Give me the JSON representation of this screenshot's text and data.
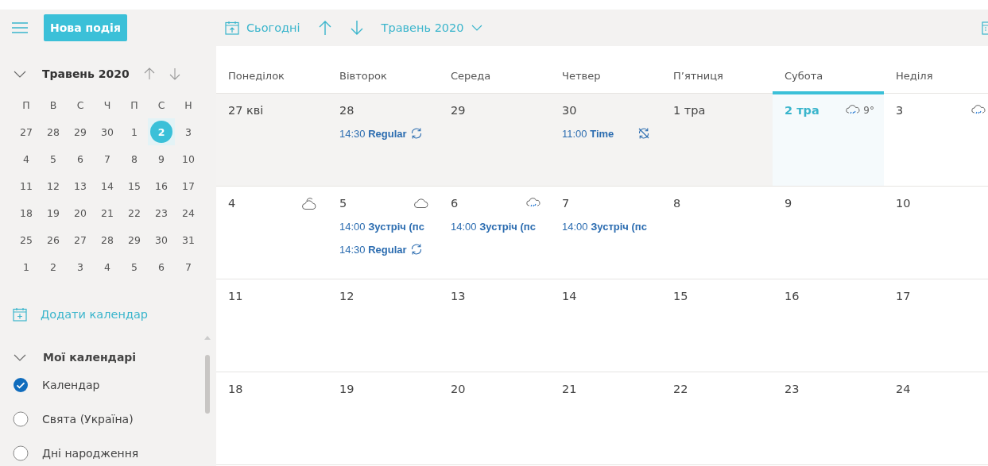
{
  "toolbar": {
    "new_event": "Нова подія",
    "today": "Сьогодні",
    "period": "Травень 2020"
  },
  "mini_calendar": {
    "title": "Травень 2020",
    "weekdays": [
      "П",
      "В",
      "С",
      "Ч",
      "П",
      "С",
      "Н"
    ],
    "weeks": [
      [
        {
          "label": "27",
          "selected": false
        },
        {
          "label": "28",
          "selected": false
        },
        {
          "label": "29",
          "selected": false
        },
        {
          "label": "30",
          "selected": false
        },
        {
          "label": "1",
          "selected": false
        },
        {
          "label": "2",
          "selected": true
        },
        {
          "label": "3",
          "selected": false
        }
      ],
      [
        {
          "label": "4",
          "selected": false
        },
        {
          "label": "5",
          "selected": false
        },
        {
          "label": "6",
          "selected": false
        },
        {
          "label": "7",
          "selected": false
        },
        {
          "label": "8",
          "selected": false
        },
        {
          "label": "9",
          "selected": false
        },
        {
          "label": "10",
          "selected": false
        }
      ],
      [
        {
          "label": "11",
          "selected": false
        },
        {
          "label": "12",
          "selected": false
        },
        {
          "label": "13",
          "selected": false
        },
        {
          "label": "14",
          "selected": false
        },
        {
          "label": "15",
          "selected": false
        },
        {
          "label": "16",
          "selected": false
        },
        {
          "label": "17",
          "selected": false
        }
      ],
      [
        {
          "label": "18",
          "selected": false
        },
        {
          "label": "19",
          "selected": false
        },
        {
          "label": "20",
          "selected": false
        },
        {
          "label": "21",
          "selected": false
        },
        {
          "label": "22",
          "selected": false
        },
        {
          "label": "23",
          "selected": false
        },
        {
          "label": "24",
          "selected": false
        }
      ],
      [
        {
          "label": "25",
          "selected": false
        },
        {
          "label": "26",
          "selected": false
        },
        {
          "label": "27",
          "selected": false
        },
        {
          "label": "28",
          "selected": false
        },
        {
          "label": "29",
          "selected": false
        },
        {
          "label": "30",
          "selected": false
        },
        {
          "label": "31",
          "selected": false
        }
      ],
      [
        {
          "label": "1",
          "selected": false
        },
        {
          "label": "2",
          "selected": false
        },
        {
          "label": "3",
          "selected": false
        },
        {
          "label": "4",
          "selected": false
        },
        {
          "label": "5",
          "selected": false
        },
        {
          "label": "6",
          "selected": false
        },
        {
          "label": "7",
          "selected": false
        }
      ]
    ]
  },
  "add_calendar": "Додати календар",
  "my_calendars": {
    "title": "Мої календарі",
    "expanded": true,
    "items": [
      {
        "label": "Календар",
        "checked": true
      },
      {
        "label": "Свята (Україна)",
        "checked": false
      },
      {
        "label": "Дні народження",
        "checked": false
      }
    ]
  },
  "columns": [
    {
      "label": "Понеділок",
      "selected": false
    },
    {
      "label": "Вівторок",
      "selected": false
    },
    {
      "label": "Середа",
      "selected": false
    },
    {
      "label": "Четвер",
      "selected": false
    },
    {
      "label": "П’ятниця",
      "selected": false
    },
    {
      "label": "Субота",
      "selected": true
    },
    {
      "label": "Неділя",
      "selected": false
    }
  ],
  "weeks": [
    [
      {
        "label": "27 кві",
        "kind": "plain",
        "outside": true,
        "today": false
      },
      {
        "label": "28",
        "kind": "plain",
        "outside": true,
        "today": false,
        "events": [
          {
            "time": "14:30",
            "title": "Regular",
            "kind": "recurring"
          }
        ]
      },
      {
        "label": "29",
        "kind": "plain",
        "outside": true,
        "today": false
      },
      {
        "label": "30",
        "kind": "plain",
        "outside": true,
        "today": false,
        "events": [
          {
            "time": "11:00",
            "title": "Time",
            "kind": "exception"
          }
        ]
      },
      {
        "label": "1 тра",
        "kind": "plain",
        "outside": true,
        "today": false
      },
      {
        "label": "2 тра",
        "kind": "rain",
        "outside": false,
        "today": true,
        "temp": "9°"
      },
      {
        "label": "3",
        "kind": "rain",
        "outside": false,
        "today": false
      }
    ],
    [
      {
        "label": "4",
        "kind": "partly-cloudy",
        "outside": false,
        "today": false
      },
      {
        "label": "5",
        "kind": "cloudy",
        "outside": false,
        "today": false,
        "events": [
          {
            "time": "14:00",
            "title": "Зустріч (пс",
            "kind": "single"
          },
          {
            "time": "14:30",
            "title": "Regular",
            "kind": "recurring"
          }
        ]
      },
      {
        "label": "6",
        "kind": "rain",
        "outside": false,
        "today": false,
        "events": [
          {
            "time": "14:00",
            "title": "Зустріч (пс",
            "kind": "single"
          }
        ]
      },
      {
        "label": "7",
        "kind": "plain",
        "outside": false,
        "today": false,
        "events": [
          {
            "time": "14:00",
            "title": "Зустріч (пс",
            "kind": "single"
          }
        ]
      },
      {
        "label": "8",
        "kind": "plain",
        "outside": false,
        "today": false
      },
      {
        "label": "9",
        "kind": "plain",
        "outside": false,
        "today": false
      },
      {
        "label": "10",
        "kind": "plain",
        "outside": false,
        "today": false
      }
    ],
    [
      {
        "label": "11",
        "kind": "plain",
        "outside": false,
        "today": false
      },
      {
        "label": "12",
        "kind": "plain",
        "outside": false,
        "today": false
      },
      {
        "label": "13",
        "kind": "plain",
        "outside": false,
        "today": false
      },
      {
        "label": "14",
        "kind": "plain",
        "outside": false,
        "today": false
      },
      {
        "label": "15",
        "kind": "plain",
        "outside": false,
        "today": false
      },
      {
        "label": "16",
        "kind": "plain",
        "outside": false,
        "today": false
      },
      {
        "label": "17",
        "kind": "plain",
        "outside": false,
        "today": false
      }
    ],
    [
      {
        "label": "18",
        "kind": "plain",
        "outside": false,
        "today": false
      },
      {
        "label": "19",
        "kind": "plain",
        "outside": false,
        "today": false
      },
      {
        "label": "20",
        "kind": "plain",
        "outside": false,
        "today": false
      },
      {
        "label": "21",
        "kind": "plain",
        "outside": false,
        "today": false
      },
      {
        "label": "22",
        "kind": "plain",
        "outside": false,
        "today": false
      },
      {
        "label": "23",
        "kind": "plain",
        "outside": false,
        "today": false
      },
      {
        "label": "24",
        "kind": "plain",
        "outside": false,
        "today": false
      }
    ]
  ]
}
